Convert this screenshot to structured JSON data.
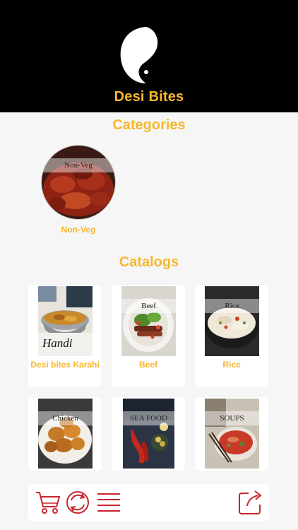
{
  "header": {
    "title": "Desi Bites",
    "logo_icon": "yin-yang-icon"
  },
  "categories": {
    "title": "Categories",
    "items": [
      {
        "label": "Non-Veg",
        "overlay": "Non-Veg"
      }
    ]
  },
  "catalogs": {
    "title": "Catalogs",
    "items": [
      {
        "label": "Desi bites Karahi",
        "overlay": "Handi"
      },
      {
        "label": "Beef",
        "overlay": "Beef"
      },
      {
        "label": "Rice",
        "overlay": "Rice"
      },
      {
        "label": "",
        "overlay": "Chicken"
      },
      {
        "label": "",
        "overlay": "SEA FOOD"
      },
      {
        "label": "",
        "overlay": "SOUPS"
      }
    ]
  },
  "toolbar": {
    "icons": [
      "cart-icon",
      "refresh-icon",
      "menu-icon",
      "share-icon"
    ],
    "accent": "#c8262e"
  },
  "colors": {
    "brand": "#f7b72d",
    "header_bg": "#000000",
    "page_bg": "#f6f6f6"
  }
}
